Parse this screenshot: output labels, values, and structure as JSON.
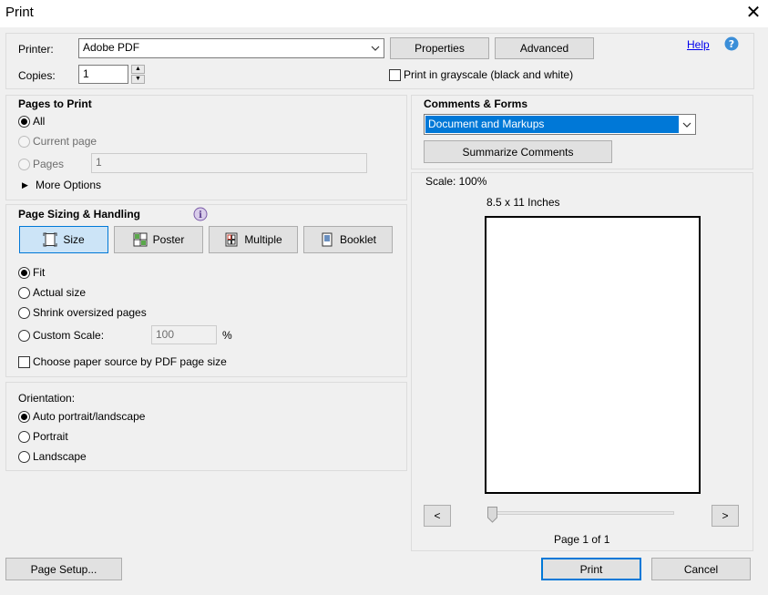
{
  "window": {
    "title": "Print",
    "close_glyph": "✕"
  },
  "printer": {
    "label": "Printer:",
    "selected": "Adobe PDF",
    "properties_label": "Properties",
    "advanced_label": "Advanced",
    "help_label": "Help",
    "copies_label": "Copies:",
    "copies_value": "1",
    "grayscale_label": "Print in grayscale (black and white)"
  },
  "pages_to_print": {
    "heading": "Pages to Print",
    "all_label": "All",
    "current_page_label": "Current page",
    "pages_label": "Pages",
    "pages_value": "1",
    "more_options_label": "More Options"
  },
  "page_sizing": {
    "heading": "Page Sizing & Handling",
    "tabs": [
      {
        "label": "Size"
      },
      {
        "label": "Poster"
      },
      {
        "label": "Multiple"
      },
      {
        "label": "Booklet"
      }
    ],
    "fit_label": "Fit",
    "actual_size_label": "Actual size",
    "shrink_label": "Shrink oversized pages",
    "custom_scale_label": "Custom Scale:",
    "custom_scale_value": "100",
    "percent": "%",
    "paper_source_label": "Choose paper source by PDF page size"
  },
  "orientation": {
    "heading": "Orientation:",
    "auto_label": "Auto portrait/landscape",
    "portrait_label": "Portrait",
    "landscape_label": "Landscape"
  },
  "comments_forms": {
    "heading": "Comments & Forms",
    "selected": "Document and Markups",
    "summarize_label": "Summarize Comments"
  },
  "preview": {
    "scale_text": "Scale: 100%",
    "paper_size": "8.5 x 11 Inches",
    "prev": "<",
    "next": ">",
    "page_text": "Page 1 of 1"
  },
  "footer": {
    "page_setup_label": "Page Setup...",
    "print_label": "Print",
    "cancel_label": "Cancel"
  },
  "colors": {
    "accent": "#0078d7",
    "selection": "#0078d7",
    "help_icon": "#3b8ed8",
    "info_icon": "#7a5aa8"
  }
}
